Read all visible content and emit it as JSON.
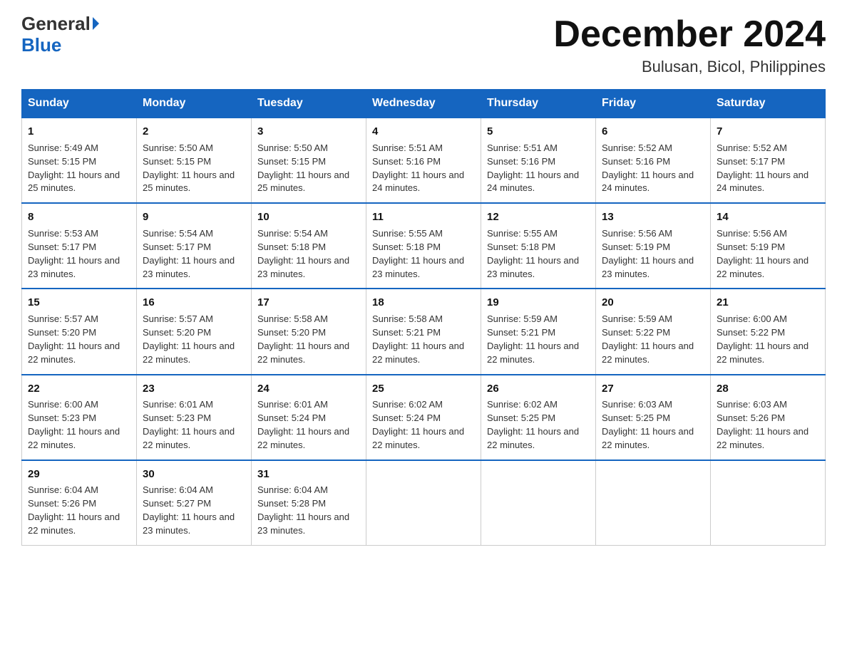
{
  "logo": {
    "general": "General",
    "blue": "Blue"
  },
  "title": "December 2024",
  "location": "Bulusan, Bicol, Philippines",
  "days_of_week": [
    "Sunday",
    "Monday",
    "Tuesday",
    "Wednesday",
    "Thursday",
    "Friday",
    "Saturday"
  ],
  "weeks": [
    [
      {
        "day": "1",
        "sunrise": "5:49 AM",
        "sunset": "5:15 PM",
        "daylight": "11 hours and 25 minutes."
      },
      {
        "day": "2",
        "sunrise": "5:50 AM",
        "sunset": "5:15 PM",
        "daylight": "11 hours and 25 minutes."
      },
      {
        "day": "3",
        "sunrise": "5:50 AM",
        "sunset": "5:15 PM",
        "daylight": "11 hours and 25 minutes."
      },
      {
        "day": "4",
        "sunrise": "5:51 AM",
        "sunset": "5:16 PM",
        "daylight": "11 hours and 24 minutes."
      },
      {
        "day": "5",
        "sunrise": "5:51 AM",
        "sunset": "5:16 PM",
        "daylight": "11 hours and 24 minutes."
      },
      {
        "day": "6",
        "sunrise": "5:52 AM",
        "sunset": "5:16 PM",
        "daylight": "11 hours and 24 minutes."
      },
      {
        "day": "7",
        "sunrise": "5:52 AM",
        "sunset": "5:17 PM",
        "daylight": "11 hours and 24 minutes."
      }
    ],
    [
      {
        "day": "8",
        "sunrise": "5:53 AM",
        "sunset": "5:17 PM",
        "daylight": "11 hours and 23 minutes."
      },
      {
        "day": "9",
        "sunrise": "5:54 AM",
        "sunset": "5:17 PM",
        "daylight": "11 hours and 23 minutes."
      },
      {
        "day": "10",
        "sunrise": "5:54 AM",
        "sunset": "5:18 PM",
        "daylight": "11 hours and 23 minutes."
      },
      {
        "day": "11",
        "sunrise": "5:55 AM",
        "sunset": "5:18 PM",
        "daylight": "11 hours and 23 minutes."
      },
      {
        "day": "12",
        "sunrise": "5:55 AM",
        "sunset": "5:18 PM",
        "daylight": "11 hours and 23 minutes."
      },
      {
        "day": "13",
        "sunrise": "5:56 AM",
        "sunset": "5:19 PM",
        "daylight": "11 hours and 23 minutes."
      },
      {
        "day": "14",
        "sunrise": "5:56 AM",
        "sunset": "5:19 PM",
        "daylight": "11 hours and 22 minutes."
      }
    ],
    [
      {
        "day": "15",
        "sunrise": "5:57 AM",
        "sunset": "5:20 PM",
        "daylight": "11 hours and 22 minutes."
      },
      {
        "day": "16",
        "sunrise": "5:57 AM",
        "sunset": "5:20 PM",
        "daylight": "11 hours and 22 minutes."
      },
      {
        "day": "17",
        "sunrise": "5:58 AM",
        "sunset": "5:20 PM",
        "daylight": "11 hours and 22 minutes."
      },
      {
        "day": "18",
        "sunrise": "5:58 AM",
        "sunset": "5:21 PM",
        "daylight": "11 hours and 22 minutes."
      },
      {
        "day": "19",
        "sunrise": "5:59 AM",
        "sunset": "5:21 PM",
        "daylight": "11 hours and 22 minutes."
      },
      {
        "day": "20",
        "sunrise": "5:59 AM",
        "sunset": "5:22 PM",
        "daylight": "11 hours and 22 minutes."
      },
      {
        "day": "21",
        "sunrise": "6:00 AM",
        "sunset": "5:22 PM",
        "daylight": "11 hours and 22 minutes."
      }
    ],
    [
      {
        "day": "22",
        "sunrise": "6:00 AM",
        "sunset": "5:23 PM",
        "daylight": "11 hours and 22 minutes."
      },
      {
        "day": "23",
        "sunrise": "6:01 AM",
        "sunset": "5:23 PM",
        "daylight": "11 hours and 22 minutes."
      },
      {
        "day": "24",
        "sunrise": "6:01 AM",
        "sunset": "5:24 PM",
        "daylight": "11 hours and 22 minutes."
      },
      {
        "day": "25",
        "sunrise": "6:02 AM",
        "sunset": "5:24 PM",
        "daylight": "11 hours and 22 minutes."
      },
      {
        "day": "26",
        "sunrise": "6:02 AM",
        "sunset": "5:25 PM",
        "daylight": "11 hours and 22 minutes."
      },
      {
        "day": "27",
        "sunrise": "6:03 AM",
        "sunset": "5:25 PM",
        "daylight": "11 hours and 22 minutes."
      },
      {
        "day": "28",
        "sunrise": "6:03 AM",
        "sunset": "5:26 PM",
        "daylight": "11 hours and 22 minutes."
      }
    ],
    [
      {
        "day": "29",
        "sunrise": "6:04 AM",
        "sunset": "5:26 PM",
        "daylight": "11 hours and 22 minutes."
      },
      {
        "day": "30",
        "sunrise": "6:04 AM",
        "sunset": "5:27 PM",
        "daylight": "11 hours and 23 minutes."
      },
      {
        "day": "31",
        "sunrise": "6:04 AM",
        "sunset": "5:28 PM",
        "daylight": "11 hours and 23 minutes."
      },
      null,
      null,
      null,
      null
    ]
  ]
}
